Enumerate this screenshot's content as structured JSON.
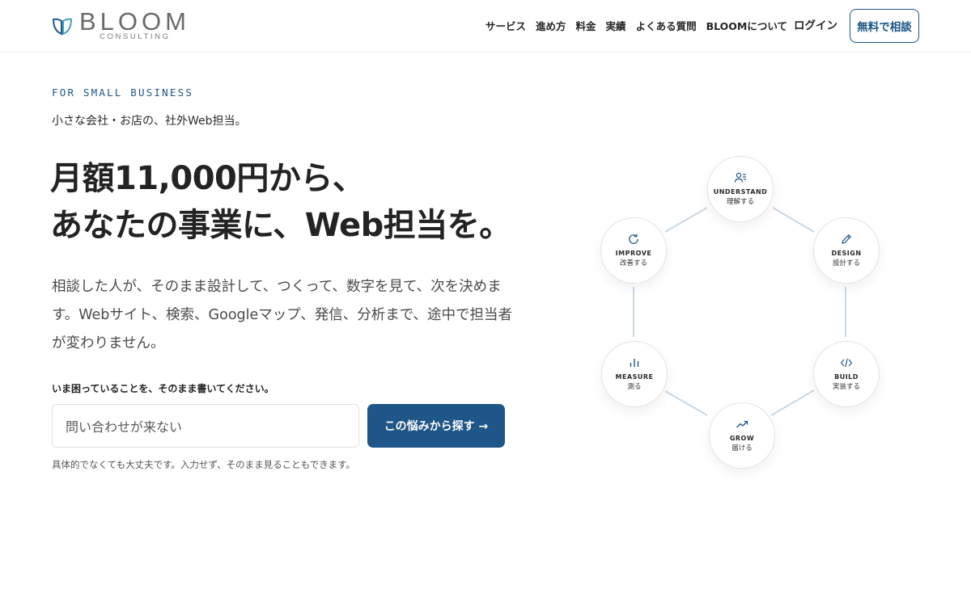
{
  "brand": {
    "name": "BLOOM",
    "sub": "CONSULTING",
    "accent": "#1f5688",
    "mark_colors": [
      "#1f5688",
      "#3fa6b8"
    ]
  },
  "nav": {
    "items": [
      "サービス",
      "進め方",
      "料金",
      "実績",
      "よくある質問",
      "BLOOMについて"
    ],
    "login": "ログイン",
    "cta": "無料で相談"
  },
  "hero": {
    "eyebrow": "FOR SMALL BUSINESS",
    "lead": "小さな会社・お店の、社外Web担当。",
    "headline_1": "月額11,000円から、",
    "headline_2": "あなたの事業に、Web担当を。",
    "description": "相談した人が、そのまま設計して、つくって、数字を見て、次を決めます。Webサイト、検索、Googleマップ、発信、分析まで、途中で担当者が変わりません。",
    "input_label": "いま困っていることを、そのまま書いてください。",
    "input_value": "問い合わせが来ない",
    "search_button": "この悩みから探す →",
    "note": "具体的でなくても大丈夫です。入力せず、そのまま見ることもできます。"
  },
  "cycle": {
    "nodes": [
      {
        "en": "UNDERSTAND",
        "jp": "理解する",
        "icon": "user-list-icon"
      },
      {
        "en": "DESIGN",
        "jp": "設計する",
        "icon": "pencil-icon"
      },
      {
        "en": "BUILD",
        "jp": "実装する",
        "icon": "code-icon"
      },
      {
        "en": "GROW",
        "jp": "届ける",
        "icon": "trending-up-icon"
      },
      {
        "en": "MEASURE",
        "jp": "測る",
        "icon": "bar-chart-icon"
      },
      {
        "en": "IMPROVE",
        "jp": "改善する",
        "icon": "refresh-icon"
      }
    ],
    "line_color": "#c9d8e4",
    "icon_color": "#1f5688"
  }
}
